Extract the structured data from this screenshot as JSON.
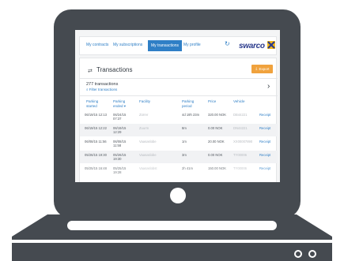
{
  "nav": {
    "tabs": [
      {
        "label": "My contracts"
      },
      {
        "label": "My subscriptions"
      },
      {
        "label": "My transactions",
        "active": true
      },
      {
        "label": "My profile"
      }
    ],
    "refresh_icon": "↻",
    "logo_text": "swarco"
  },
  "transactions": {
    "title": "Transactions",
    "title_icon": "⇄",
    "export_label": "Export",
    "count": "277 transactions",
    "filter_label": "Filter transactions",
    "filter_icon": "⌕",
    "chevron": "›",
    "columns": [
      "Parking started",
      "Parking ended ▾",
      "Facility",
      "Parking period",
      "Price",
      "Vehicle",
      ""
    ],
    "rows": [
      {
        "started": "06/19/15 12:13",
        "ended": "06/24/15 07:37",
        "facility": "Zürrer",
        "period": "4d 19h 23m",
        "price": "320.00 NOK",
        "vehicle": "DB44221",
        "action": "Receipt"
      },
      {
        "started": "06/19/15 12:22",
        "ended": "06/19/15 12:29",
        "facility": "Zuurm",
        "period": "8m",
        "price": "0.00 NOK",
        "vehicle": "DN44221",
        "action": "Receipt"
      },
      {
        "started": "06/08/15 11:56",
        "ended": "06/08/15 11:58",
        "facility": "Vaasaslobe",
        "period": "1m",
        "price": "20.00 NOK",
        "vehicle": "XX00007890",
        "action": "Receipt"
      },
      {
        "started": "05/26/15 19:30",
        "ended": "05/26/15 19:30",
        "facility": "Vaasaslobe",
        "period": "3m",
        "price": "0.00 NOK",
        "vehicle": "TY00006",
        "action": "Receipt"
      },
      {
        "started": "05/25/15 16:48",
        "ended": "05/25/15 19:28",
        "facility": "Vaasaslobst",
        "period": "2h 41m",
        "price": "150.00 NOK",
        "vehicle": "TY00006",
        "action": "Receipt"
      }
    ]
  },
  "colors": {
    "frame": "#454a50",
    "accent": "#2f7fc6",
    "export": "#f0a23d"
  }
}
